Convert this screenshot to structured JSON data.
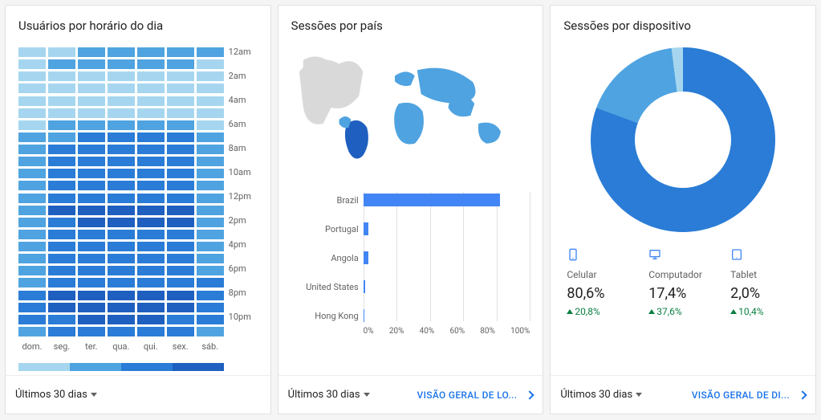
{
  "palette": {
    "b1": "#a6d6ef",
    "b2": "#4fa3e0",
    "b3": "#2a7cd6",
    "b4": "#1f5fbf"
  },
  "cards": {
    "heatmap": {
      "title": "Usuários por horário do dia",
      "range_label": "Últimos 30 dias"
    },
    "map": {
      "title": "Sessões por país",
      "range_label": "Últimos 30 dias",
      "link": "VISÃO GERAL DE LO..."
    },
    "device": {
      "title": "Sessões por dispositivo",
      "range_label": "Últimos 30 dias",
      "link": "VISÃO GERAL DE DI..."
    }
  },
  "devices": [
    {
      "name": "Celular",
      "value": "80,6%",
      "delta": "20,8%"
    },
    {
      "name": "Computador",
      "value": "17,4%",
      "delta": "37,6%"
    },
    {
      "name": "Tablet",
      "value": "2,0%",
      "delta": "10,4%"
    }
  ],
  "chart_data": [
    {
      "type": "heatmap",
      "title": "Usuários por horário do dia",
      "x_categories": [
        "dom.",
        "seg.",
        "ter.",
        "qua.",
        "qui.",
        "sex.",
        "sáb."
      ],
      "y_hours": [
        "12am",
        "1am",
        "2am",
        "3am",
        "4am",
        "5am",
        "6am",
        "7am",
        "8am",
        "9am",
        "10am",
        "11am",
        "12pm",
        "1pm",
        "2pm",
        "3pm",
        "4pm",
        "5pm",
        "6pm",
        "7pm",
        "8pm",
        "9pm",
        "10pm",
        "11pm"
      ],
      "y_tick_labels": [
        "12am",
        "2am",
        "4am",
        "6am",
        "8am",
        "10am",
        "12pm",
        "2pm",
        "4pm",
        "6pm",
        "8pm",
        "10pm"
      ],
      "legend_ticks": [
        0,
        200,
        400,
        600,
        800
      ],
      "intensity": [
        [
          1,
          1,
          2,
          2,
          2,
          2,
          2
        ],
        [
          1,
          2,
          2,
          2,
          2,
          2,
          1
        ],
        [
          1,
          1,
          1,
          1,
          1,
          1,
          1
        ],
        [
          1,
          1,
          1,
          1,
          1,
          1,
          1
        ],
        [
          1,
          1,
          1,
          1,
          1,
          1,
          1
        ],
        [
          1,
          1,
          1,
          1,
          1,
          1,
          1
        ],
        [
          1,
          2,
          2,
          2,
          2,
          2,
          1
        ],
        [
          2,
          2,
          3,
          3,
          3,
          3,
          2
        ],
        [
          2,
          3,
          3,
          3,
          3,
          3,
          2
        ],
        [
          2,
          3,
          3,
          3,
          3,
          3,
          2
        ],
        [
          2,
          3,
          3,
          3,
          3,
          3,
          2
        ],
        [
          2,
          3,
          3,
          3,
          3,
          3,
          2
        ],
        [
          2,
          3,
          3,
          3,
          3,
          3,
          2
        ],
        [
          2,
          4,
          4,
          4,
          4,
          4,
          2
        ],
        [
          2,
          3,
          4,
          4,
          4,
          4,
          2
        ],
        [
          2,
          3,
          3,
          3,
          3,
          3,
          2
        ],
        [
          2,
          3,
          3,
          3,
          3,
          3,
          2
        ],
        [
          2,
          3,
          3,
          3,
          3,
          3,
          2
        ],
        [
          2,
          3,
          3,
          3,
          3,
          3,
          2
        ],
        [
          2,
          3,
          3,
          3,
          3,
          3,
          3
        ],
        [
          3,
          4,
          4,
          4,
          4,
          4,
          3
        ],
        [
          3,
          4,
          4,
          4,
          4,
          4,
          3
        ],
        [
          3,
          3,
          4,
          4,
          4,
          3,
          3
        ],
        [
          2,
          3,
          3,
          3,
          3,
          3,
          2
        ]
      ]
    },
    {
      "type": "bar",
      "title": "Sessões por país",
      "orientation": "horizontal",
      "xlabel": "",
      "ylabel": "",
      "xlim": [
        0,
        100
      ],
      "x_ticks": [
        "0%",
        "20%",
        "40%",
        "60%",
        "80%",
        "100%"
      ],
      "categories": [
        "Brazil",
        "Portugal",
        "Angola",
        "United States",
        "Hong Kong"
      ],
      "values": [
        82,
        3,
        3,
        1,
        0.5
      ]
    },
    {
      "type": "pie",
      "subtype": "donut",
      "title": "Sessões por dispositivo",
      "series": [
        {
          "name": "Celular",
          "value": 80.6,
          "delta_pct": 20.8
        },
        {
          "name": "Computador",
          "value": 17.4,
          "delta_pct": 37.6
        },
        {
          "name": "Tablet",
          "value": 2.0,
          "delta_pct": 10.4
        }
      ]
    }
  ]
}
